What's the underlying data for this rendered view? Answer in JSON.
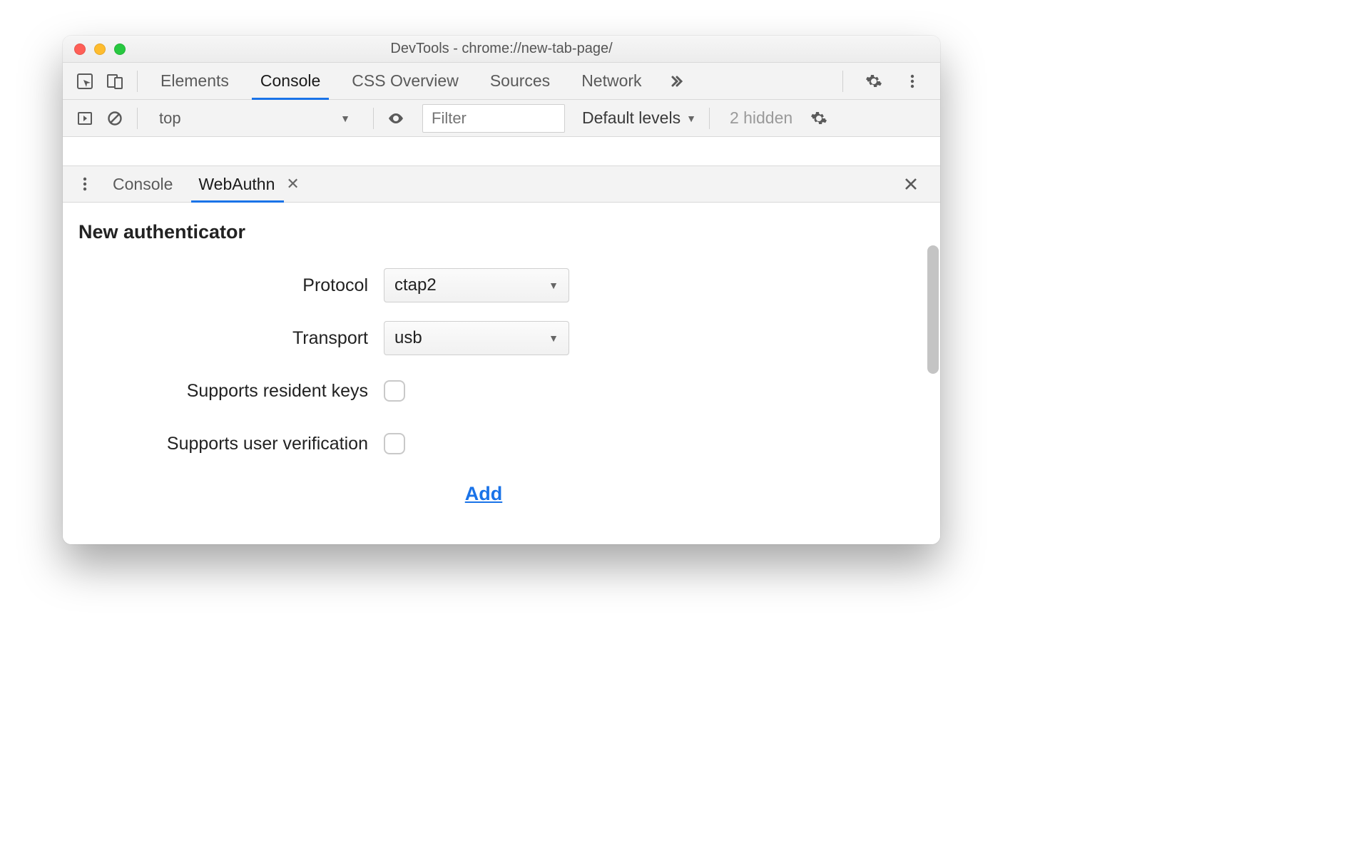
{
  "window": {
    "title": "DevTools - chrome://new-tab-page/"
  },
  "topTabs": {
    "items": [
      "Elements",
      "Console",
      "CSS Overview",
      "Sources",
      "Network"
    ],
    "activeIndex": 1
  },
  "consoleBar": {
    "context": "top",
    "filterPlaceholder": "Filter",
    "levels": "Default levels",
    "hidden": "2 hidden"
  },
  "drawer": {
    "tabs": [
      "Console",
      "WebAuthn"
    ],
    "activeIndex": 1
  },
  "webauthn": {
    "heading": "New authenticator",
    "fields": {
      "protocol": {
        "label": "Protocol",
        "value": "ctap2"
      },
      "transport": {
        "label": "Transport",
        "value": "usb"
      },
      "residentKeys": {
        "label": "Supports resident keys",
        "checked": false
      },
      "userVerification": {
        "label": "Supports user verification",
        "checked": false
      }
    },
    "addLabel": "Add"
  }
}
